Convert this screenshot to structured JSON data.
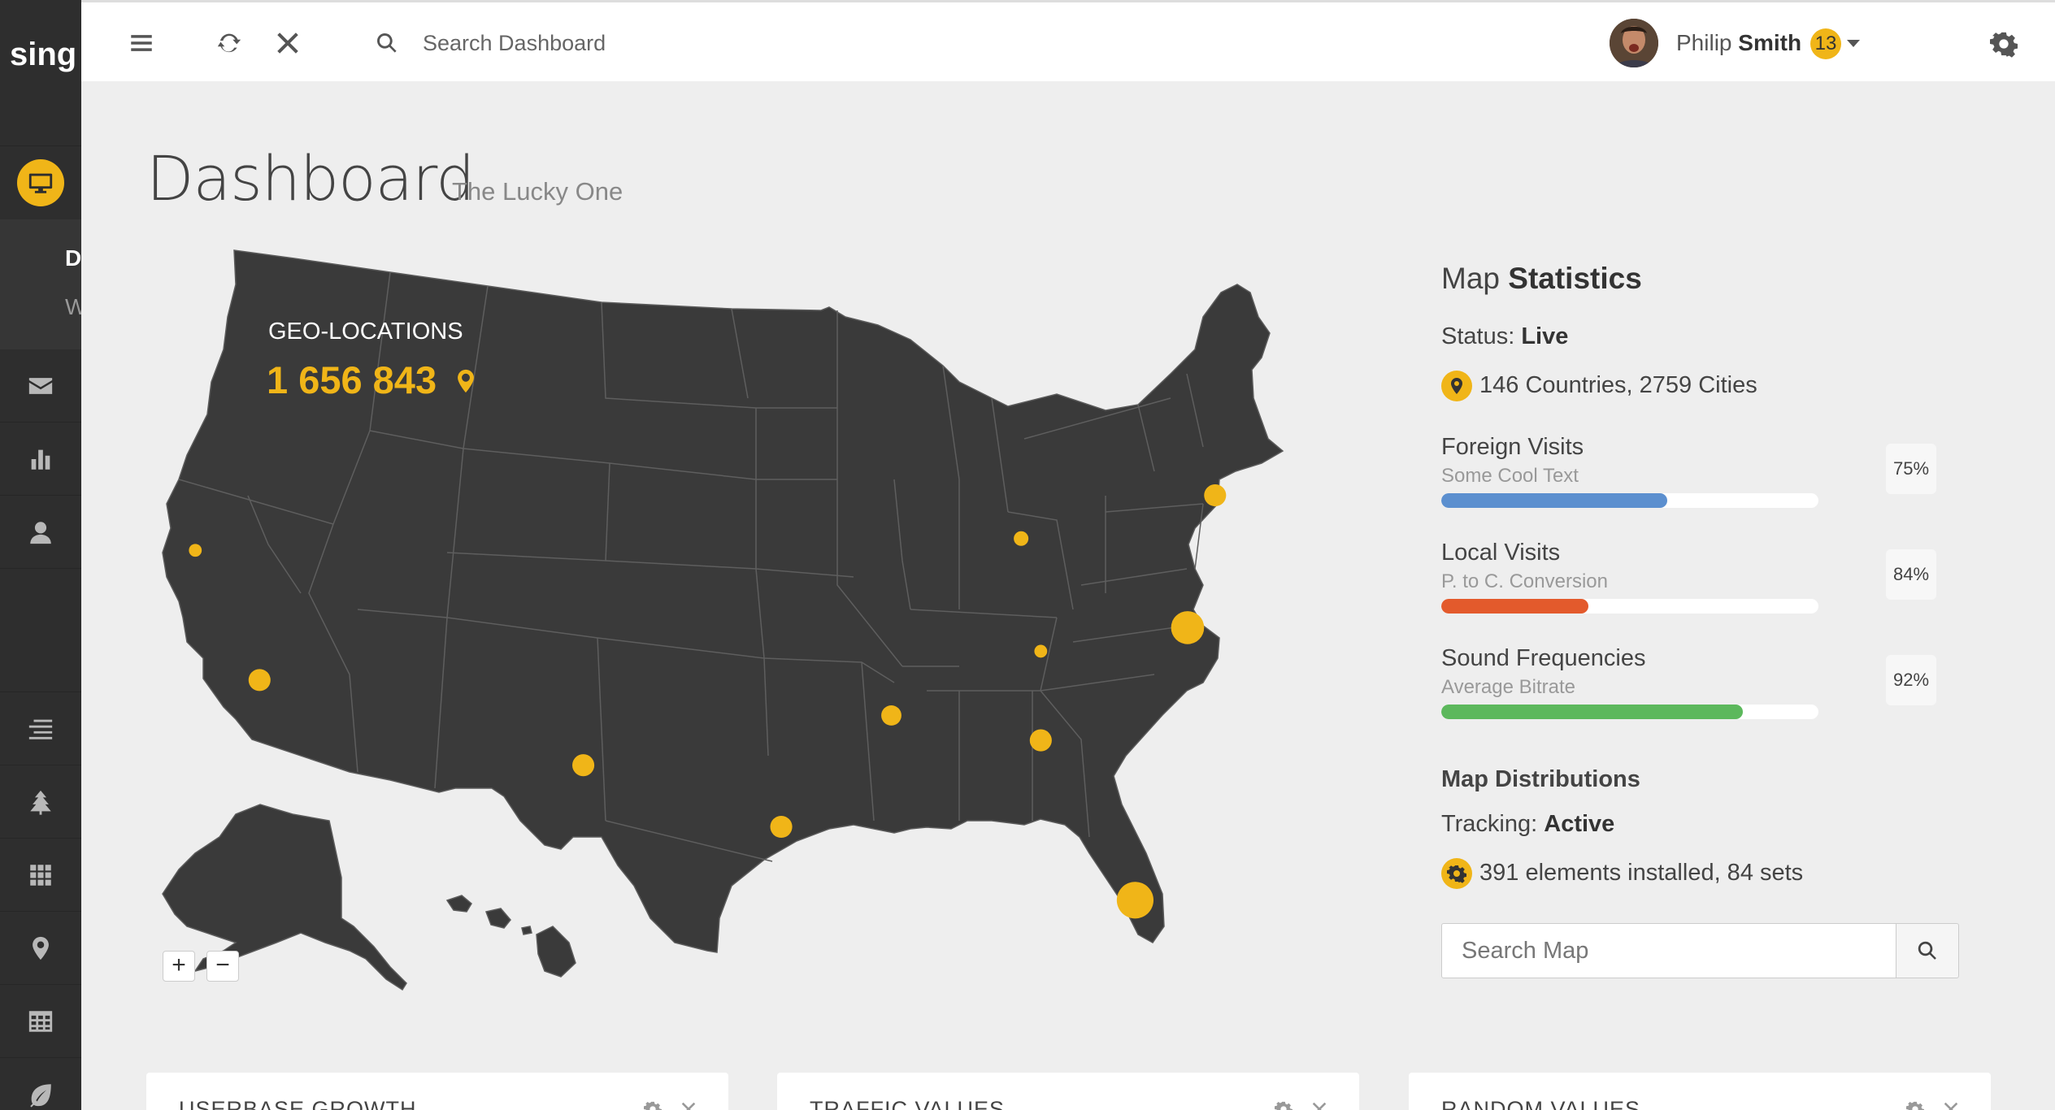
{
  "brand": {
    "logo": "sing",
    "accent": "#f0b518",
    "sidebar_bg": "#2e2e2e"
  },
  "sidebar": {
    "active_item": "dashboard",
    "submenu": {
      "item1": "D",
      "item2": "W"
    },
    "items": [
      {
        "id": "dashboard",
        "icon": "monitor-icon"
      },
      {
        "id": "inbox",
        "icon": "envelope-icon"
      },
      {
        "id": "charts",
        "icon": "bar-chart-icon"
      },
      {
        "id": "profile",
        "icon": "user-icon"
      },
      {
        "id": "forms",
        "icon": "align-icon"
      },
      {
        "id": "tree",
        "icon": "tree-icon"
      },
      {
        "id": "grid",
        "icon": "grid-icon"
      },
      {
        "id": "maps",
        "icon": "map-marker-icon"
      },
      {
        "id": "tables",
        "icon": "table-icon"
      },
      {
        "id": "extra",
        "icon": "leaf-icon"
      }
    ]
  },
  "header": {
    "search_placeholder": "Search Dashboard",
    "user_first": "Philip",
    "user_last": "Smith",
    "notif_count": "13"
  },
  "page": {
    "title": "Dashboard",
    "subtitle": "The Lucky One"
  },
  "map": {
    "geo_title": "GEO-LOCATIONS",
    "geo_value": "1 656 843",
    "zoom_in": "+",
    "zoom_out": "−",
    "marker_color": "#f0b518",
    "land_color": "#3a3a3a"
  },
  "stats": {
    "title_light": "Map",
    "title_bold": "Statistics",
    "status_label": "Status:",
    "status_value": "Live",
    "countries_text": "146 Countries, 2759 Cities",
    "progress": [
      {
        "label": "Foreign Visits",
        "sub": "Some Cool Text",
        "percent": 0.6,
        "pct_text": "75%",
        "color": "#5b8fcf"
      },
      {
        "label": "Local Visits",
        "sub": "P. to C. Conversion",
        "percent": 0.39,
        "pct_text": "84%",
        "color": "#e35a2c"
      },
      {
        "label": "Sound Frequencies",
        "sub": "Average Bitrate",
        "percent": 0.8,
        "pct_text": "92%",
        "color": "#5cb85c"
      }
    ],
    "dist_title": "Map Distributions",
    "tracking_label": "Tracking:",
    "tracking_value": "Active",
    "installed_text": "391 elements installed, 84 sets",
    "map_search_placeholder": "Search Map"
  },
  "widgets": [
    {
      "title": "USERBASE GROWTH"
    },
    {
      "title": "TRAFFIC VALUES"
    },
    {
      "title": "RANDOM VALUES"
    }
  ]
}
